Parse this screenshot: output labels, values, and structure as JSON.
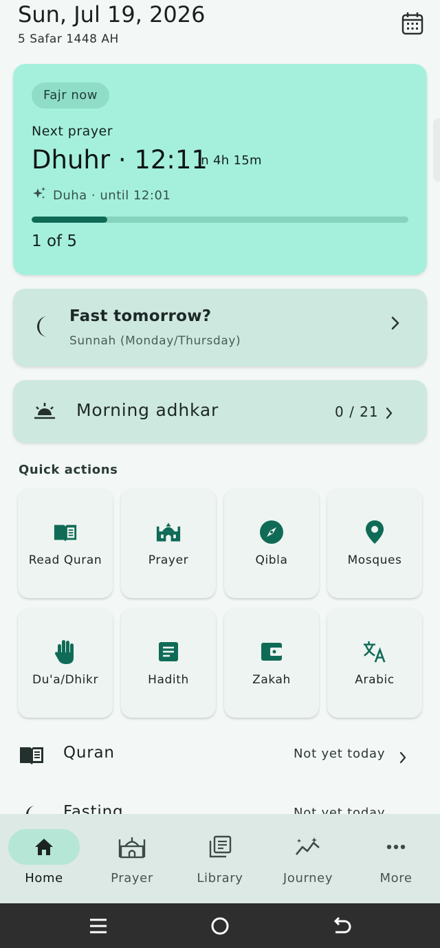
{
  "header": {
    "date": "Sun, Jul 19, 2026",
    "hijri": "5 Safar 1448 AH",
    "calendar_icon": "calendar-icon"
  },
  "prayer_card": {
    "current_pill": "Fajr now",
    "next_label": "Next prayer",
    "next_prayer": "Dhuhr · 12:11",
    "time_until": "in 4h 15m",
    "duha_text": "Duha · until 12:01",
    "progress_fraction": 0.2,
    "count": "1 of 5",
    "colors": {
      "background": "#a5f0dc",
      "progress_fill": "#0f6b56",
      "progress_track": "#85d2bd"
    }
  },
  "fast_card": {
    "title": "Fast tomorrow?",
    "subtitle": "Sunnah (Monday/Thursday)",
    "icon": "moon-icon"
  },
  "adhkar_card": {
    "title": "Morning adhkar",
    "count": "0 / 21",
    "icon": "sunrise-icon"
  },
  "quick_actions": {
    "title": "Quick actions",
    "items": [
      {
        "label": "Read Quran",
        "icon": "book-icon"
      },
      {
        "label": "Prayer",
        "icon": "mosque-icon"
      },
      {
        "label": "Qibla",
        "icon": "compass-icon"
      },
      {
        "label": "Mosques",
        "icon": "location-pin-icon"
      },
      {
        "label": "Du'a/Dhikr",
        "icon": "hand-icon"
      },
      {
        "label": "Hadith",
        "icon": "article-icon"
      },
      {
        "label": "Zakah",
        "icon": "wallet-icon"
      },
      {
        "label": "Arabic",
        "icon": "translate-icon"
      }
    ],
    "accent_color": "#0f6b56"
  },
  "rows": {
    "quran": {
      "label": "Quran",
      "status": "Not yet today"
    },
    "partial": {
      "label": "Fasting",
      "status": "Not yet today"
    }
  },
  "bottom_nav": {
    "items": [
      {
        "label": "Home",
        "icon": "home-icon",
        "active": true
      },
      {
        "label": "Prayer",
        "icon": "mosque-icon"
      },
      {
        "label": "Library",
        "icon": "library-icon"
      },
      {
        "label": "Journey",
        "icon": "journey-icon"
      },
      {
        "label": "More",
        "icon": "more-icon"
      }
    ]
  },
  "system_nav": {
    "recents_icon": "recents-icon",
    "home_icon": "system-home-icon",
    "back_icon": "back-icon"
  }
}
